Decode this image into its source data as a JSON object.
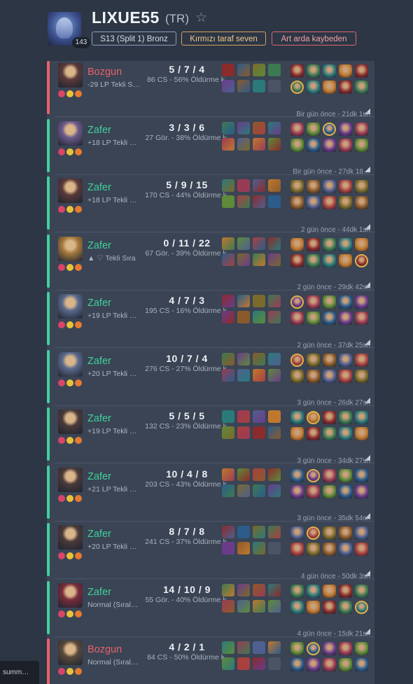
{
  "profile": {
    "name": "LIXUE55",
    "region": "(TR)",
    "level": "143",
    "favorite_icon": "star-outline-icon",
    "tags": [
      "S13 (Split 1) Bronz",
      "Kırmızı taraf seven",
      "Art arda kaybeden"
    ]
  },
  "matches": [
    {
      "result": "Bozgun",
      "outcome": "loss",
      "lp": "-29 LP Tekli S…",
      "kda": "5 / 7 / 4",
      "cs": "86 CS - 56% Öldürme k.",
      "time": ""
    },
    {
      "result": "Zafer",
      "outcome": "win",
      "lp": "+18 LP Tekli …",
      "kda": "3 / 3 / 6",
      "cs": "27 Gör. - 38% Öldürme k.",
      "time": "Bir gün önce - 21dk 1sn"
    },
    {
      "result": "Zafer",
      "outcome": "win",
      "lp": "+18 LP Tekli …",
      "kda": "5 / 9 / 15",
      "cs": "170 CS - 44% Öldürme k.",
      "time": "Bir gün önce - 27dk 18…"
    },
    {
      "result": "Zafer",
      "outcome": "win",
      "lp": "▲ ♡ Tekli Sıra",
      "kda": "0 / 11 / 22",
      "cs": "67 Gör. - 39% Öldürme k.",
      "time": "2 gün önce - 44dk 1sn"
    },
    {
      "result": "Zafer",
      "outcome": "win",
      "lp": "+19 LP Tekli …",
      "kda": "4 / 7 / 3",
      "cs": "195 CS - 16% Öldürme k.",
      "time": "2 gün önce - 29dk 42sn"
    },
    {
      "result": "Zafer",
      "outcome": "win",
      "lp": "+20 LP Tekli …",
      "kda": "10 / 7 / 4",
      "cs": "276 CS - 27% Öldürme k.",
      "time": "2 gün önce - 37dk 25sn"
    },
    {
      "result": "Zafer",
      "outcome": "win",
      "lp": "+19 LP Tekli …",
      "kda": "5 / 5 / 5",
      "cs": "132 CS - 23% Öldürme k.",
      "time": "3 gün önce - 26dk 27sn"
    },
    {
      "result": "Zafer",
      "outcome": "win",
      "lp": "+21 LP Tekli …",
      "kda": "10 / 4 / 8",
      "cs": "203 CS - 43% Öldürme k.",
      "time": "3 gün önce - 34dk 27sn"
    },
    {
      "result": "Zafer",
      "outcome": "win",
      "lp": "+20 LP Tekli …",
      "kda": "8 / 7 / 8",
      "cs": "241 CS - 37% Öldürme k.",
      "time": "3 gün önce - 35dk 54sn"
    },
    {
      "result": "Zafer",
      "outcome": "win",
      "lp": "Normal (Sıral…",
      "kda": "14 / 10 / 9",
      "cs": "55 Gör. - 40% Öldürme k.",
      "time": "4 gün önce - 50dk 3sn"
    },
    {
      "result": "Bozgun",
      "outcome": "loss",
      "lp": "Normal (Sıral…",
      "kda": "4 / 2 / 1",
      "cs": "84 CS - 50% Öldürme k.",
      "time": "4 gün önce - 15dk 21sn"
    }
  ],
  "colors": {
    "win": "#3fd19a",
    "loss": "#e86269",
    "highlight": "#e2b24a"
  },
  "bubble": {
    "label": "summ…"
  }
}
